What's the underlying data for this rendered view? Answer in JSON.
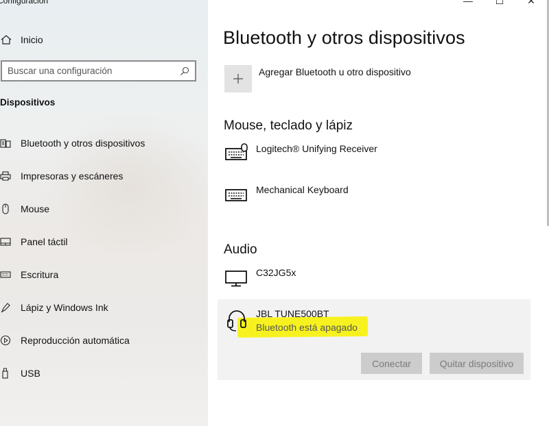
{
  "window": {
    "app_title": "Configuración",
    "controls": {
      "minimize": "—",
      "maximize": "☐",
      "close": "✕"
    }
  },
  "sidebar": {
    "home_label": "Inicio",
    "search": {
      "placeholder": "Buscar una configuración"
    },
    "section_title": "Dispositivos",
    "items": [
      {
        "label": "Bluetooth y otros dispositivos",
        "icon": "bluetooth-devices-icon"
      },
      {
        "label": "Impresoras y escáneres",
        "icon": "printer-icon"
      },
      {
        "label": "Mouse",
        "icon": "mouse-icon"
      },
      {
        "label": "Panel táctil",
        "icon": "touchpad-icon"
      },
      {
        "label": "Escritura",
        "icon": "keyboard-icon"
      },
      {
        "label": "Lápiz y Windows Ink",
        "icon": "pen-icon"
      },
      {
        "label": "Reproducción automática",
        "icon": "autoplay-icon"
      },
      {
        "label": "USB",
        "icon": "usb-icon"
      }
    ]
  },
  "main": {
    "title": "Bluetooth y otros dispositivos",
    "add_device_label": "Agregar Bluetooth u otro dispositivo",
    "groups": {
      "input": {
        "title": "Mouse, teclado y lápiz",
        "devices": [
          {
            "name": "Logitech® Unifying Receiver",
            "icon": "keyboard-mouse-icon"
          },
          {
            "name": "Mechanical Keyboard",
            "icon": "keyboard-icon"
          }
        ]
      },
      "audio": {
        "title": "Audio",
        "devices": [
          {
            "name": "C32JG5x",
            "icon": "monitor-icon"
          },
          {
            "name": "JBL TUNE500BT",
            "status": "Bluetooth está apagado",
            "icon": "headset-icon",
            "selected": true
          }
        ]
      }
    },
    "actions": {
      "connect": "Conectar",
      "remove": "Quitar dispositivo"
    }
  },
  "colors": {
    "highlight": "#f7f21f",
    "sidebar_bg": "#eceeef",
    "button_disabled": "#cccccc"
  }
}
